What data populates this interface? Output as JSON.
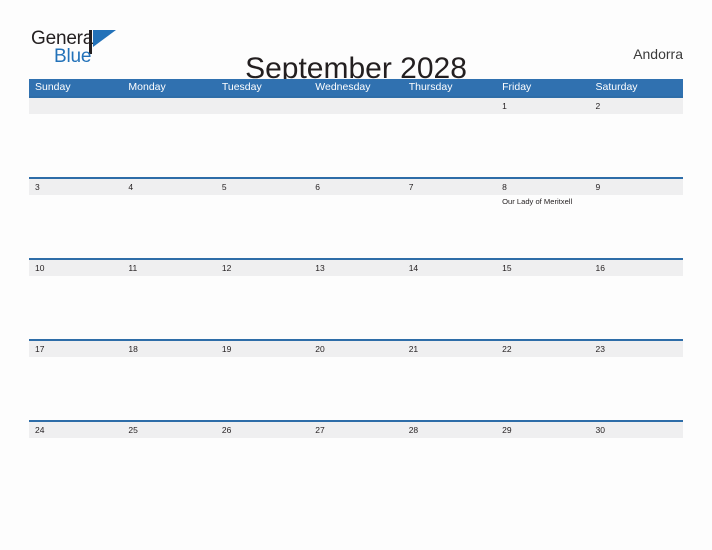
{
  "brand": {
    "name_part1": "General",
    "name_part2": "Blue",
    "flag_icon": "flag-triangle-icon",
    "accent_color": "#2372b9"
  },
  "header": {
    "title": "September 2028",
    "country": "Andorra"
  },
  "colors": {
    "header_blue": "#3071b0",
    "row_border_blue": "#2e6da8",
    "band_gray": "#efeff0",
    "page_background": "#fdfdfd",
    "text": "#231f20"
  },
  "calendar": {
    "day_headers": [
      "Sunday",
      "Monday",
      "Tuesday",
      "Wednesday",
      "Thursday",
      "Friday",
      "Saturday"
    ],
    "weeks": [
      [
        {
          "date": "",
          "events": []
        },
        {
          "date": "",
          "events": []
        },
        {
          "date": "",
          "events": []
        },
        {
          "date": "",
          "events": []
        },
        {
          "date": "",
          "events": []
        },
        {
          "date": "1",
          "events": []
        },
        {
          "date": "2",
          "events": []
        }
      ],
      [
        {
          "date": "3",
          "events": []
        },
        {
          "date": "4",
          "events": []
        },
        {
          "date": "5",
          "events": []
        },
        {
          "date": "6",
          "events": []
        },
        {
          "date": "7",
          "events": []
        },
        {
          "date": "8",
          "events": [
            "Our Lady of Meritxell"
          ]
        },
        {
          "date": "9",
          "events": []
        }
      ],
      [
        {
          "date": "10",
          "events": []
        },
        {
          "date": "11",
          "events": []
        },
        {
          "date": "12",
          "events": []
        },
        {
          "date": "13",
          "events": []
        },
        {
          "date": "14",
          "events": []
        },
        {
          "date": "15",
          "events": []
        },
        {
          "date": "16",
          "events": []
        }
      ],
      [
        {
          "date": "17",
          "events": []
        },
        {
          "date": "18",
          "events": []
        },
        {
          "date": "19",
          "events": []
        },
        {
          "date": "20",
          "events": []
        },
        {
          "date": "21",
          "events": []
        },
        {
          "date": "22",
          "events": []
        },
        {
          "date": "23",
          "events": []
        }
      ],
      [
        {
          "date": "24",
          "events": []
        },
        {
          "date": "25",
          "events": []
        },
        {
          "date": "26",
          "events": []
        },
        {
          "date": "27",
          "events": []
        },
        {
          "date": "28",
          "events": []
        },
        {
          "date": "29",
          "events": []
        },
        {
          "date": "30",
          "events": []
        }
      ]
    ]
  }
}
